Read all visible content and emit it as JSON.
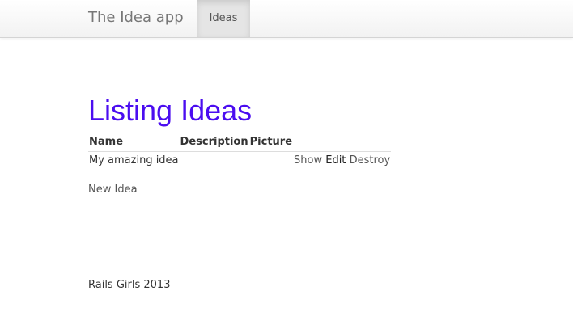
{
  "navbar": {
    "brand": "The Idea app",
    "items": [
      {
        "label": "Ideas",
        "active": true
      }
    ]
  },
  "main": {
    "title": "Listing Ideas",
    "table": {
      "headers": [
        "Name",
        "Description",
        "Picture"
      ],
      "rows": [
        {
          "name": "My amazing idea",
          "description": "",
          "picture": "",
          "actions": [
            "Show",
            "Edit",
            "Destroy"
          ]
        }
      ]
    },
    "new_link": "New Idea"
  },
  "footer": {
    "text": "Rails Girls 2013"
  },
  "colors": {
    "title": "#4b0df0",
    "navbar_bg": "#f7f7f7",
    "nav_active_bg": "#e5e5e5"
  }
}
